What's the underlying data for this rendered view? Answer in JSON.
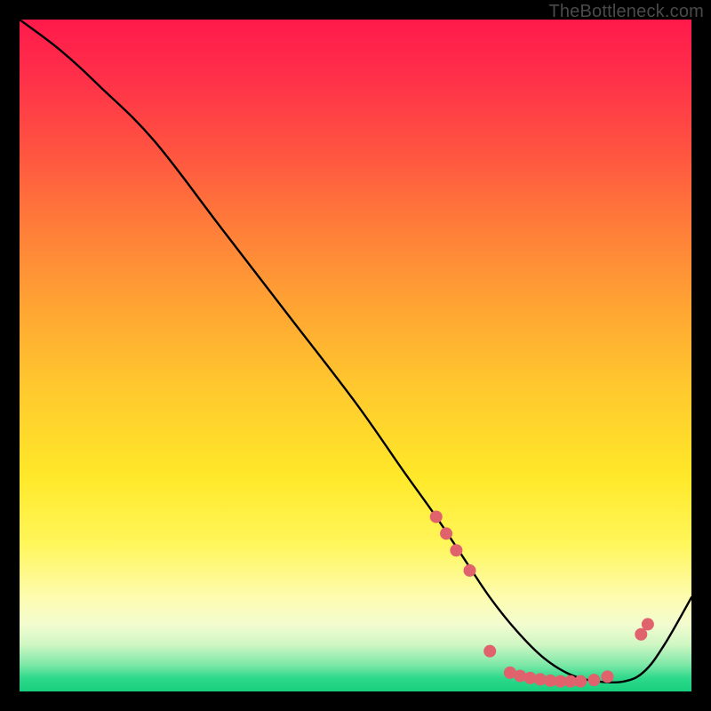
{
  "watermark": "TheBottleneck.com",
  "chart_data": {
    "type": "line",
    "title": "",
    "xlabel": "",
    "ylabel": "",
    "xlim": [
      0,
      100
    ],
    "ylim": [
      0,
      100
    ],
    "grid": false,
    "legend": false,
    "series": [
      {
        "name": "curve",
        "color": "#000000",
        "x": [
          0,
          6,
          12,
          20,
          30,
          40,
          50,
          57,
          62,
          66,
          70,
          74,
          78,
          82,
          86,
          90,
          93,
          96,
          100
        ],
        "y": [
          100,
          95.5,
          90,
          82,
          69,
          56,
          43,
          33,
          26,
          20,
          14,
          9,
          5,
          2.5,
          1.5,
          1.5,
          3,
          7,
          14
        ]
      }
    ],
    "markers": [
      {
        "name": "descent-marker",
        "x": 62.0,
        "y": 26.0,
        "color": "#e0626c",
        "r": 7
      },
      {
        "name": "descent-marker",
        "x": 63.5,
        "y": 23.5,
        "color": "#e0626c",
        "r": 7
      },
      {
        "name": "descent-marker",
        "x": 65.0,
        "y": 21.0,
        "color": "#e0626c",
        "r": 7
      },
      {
        "name": "descent-marker",
        "x": 67.0,
        "y": 18.0,
        "color": "#e0626c",
        "r": 7
      },
      {
        "name": "trough-marker",
        "x": 70.0,
        "y": 6.0,
        "color": "#e0626c",
        "r": 7
      },
      {
        "name": "trough-marker",
        "x": 73.0,
        "y": 2.8,
        "color": "#e0626c",
        "r": 7
      },
      {
        "name": "trough-marker",
        "x": 74.5,
        "y": 2.3,
        "color": "#e0626c",
        "r": 7
      },
      {
        "name": "trough-marker",
        "x": 76.0,
        "y": 2.0,
        "color": "#e0626c",
        "r": 7
      },
      {
        "name": "trough-marker",
        "x": 77.5,
        "y": 1.8,
        "color": "#e0626c",
        "r": 7
      },
      {
        "name": "trough-marker",
        "x": 79.0,
        "y": 1.6,
        "color": "#e0626c",
        "r": 7
      },
      {
        "name": "trough-marker",
        "x": 80.5,
        "y": 1.5,
        "color": "#e0626c",
        "r": 7
      },
      {
        "name": "trough-marker",
        "x": 82.0,
        "y": 1.5,
        "color": "#e0626c",
        "r": 7
      },
      {
        "name": "trough-marker",
        "x": 83.5,
        "y": 1.5,
        "color": "#e0626c",
        "r": 7
      },
      {
        "name": "trough-marker",
        "x": 85.5,
        "y": 1.7,
        "color": "#e0626c",
        "r": 7
      },
      {
        "name": "trough-marker",
        "x": 87.5,
        "y": 2.2,
        "color": "#e0626c",
        "r": 7
      },
      {
        "name": "ascent-marker",
        "x": 92.5,
        "y": 8.5,
        "color": "#e0626c",
        "r": 7
      },
      {
        "name": "ascent-marker",
        "x": 93.5,
        "y": 10.0,
        "color": "#e0626c",
        "r": 7
      }
    ]
  }
}
